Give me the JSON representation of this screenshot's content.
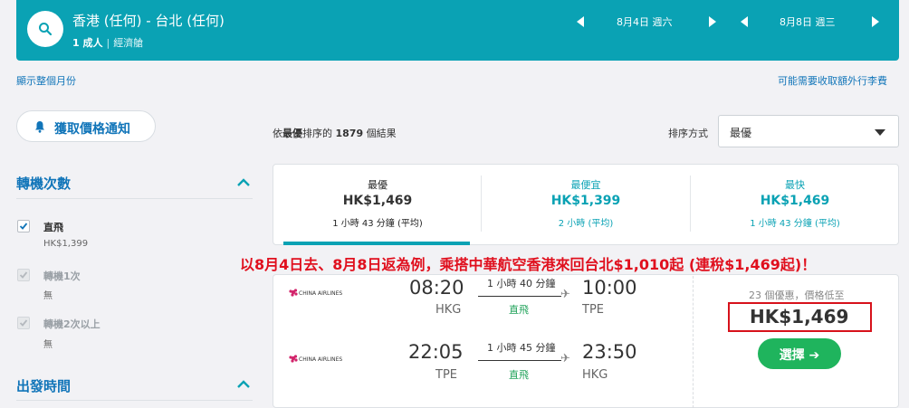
{
  "header": {
    "route": "香港 (任何) - 台北 (任何)",
    "passengers": "1 成人",
    "cabin": "經濟艙",
    "depart_date": "8月4日 週六",
    "return_date": "8月8日 週三"
  },
  "links": {
    "show_month": "顯示整個月份",
    "baggage_fee": "可能需要收取額外行李費"
  },
  "sidebar": {
    "price_alert": "獲取價格通知",
    "stops_title": "轉機次數",
    "stops": [
      {
        "label": "直飛",
        "sub": "HK$1,399",
        "checked": true,
        "disabled": false
      },
      {
        "label": "轉機1次",
        "sub": "無",
        "checked": true,
        "disabled": true
      },
      {
        "label": "轉機2次以上",
        "sub": "無",
        "checked": true,
        "disabled": true
      }
    ],
    "departure_title": "出發時間"
  },
  "results": {
    "prefix": "依",
    "sort_name": "最優",
    "middle": "排序的",
    "count": "1879",
    "suffix": "個結果",
    "sort_label": "排序方式",
    "sort_value": "最優"
  },
  "tabs": [
    {
      "label": "最優",
      "price": "HK$1,469",
      "duration": "1 小時 43 分鐘 (平均)"
    },
    {
      "label": "最便宜",
      "price": "HK$1,399",
      "duration": "2 小時 (平均)"
    },
    {
      "label": "最快",
      "price": "HK$1,469",
      "duration": "1 小時 43 分鐘 (平均)"
    }
  ],
  "annotation": "以8月4日去、8月8日返為例，乘搭中華航空香港來回台北$1,010起 (連稅$1,469起)！",
  "flight": {
    "airline": "CHINA AIRLINES",
    "outbound": {
      "depart": "08:20",
      "from": "HKG",
      "duration": "1 小時 40 分鐘",
      "stops": "直飛",
      "arrive": "10:00",
      "to": "TPE"
    },
    "inbound": {
      "depart": "22:05",
      "from": "TPE",
      "duration": "1 小時 45 分鐘",
      "stops": "直飛",
      "arrive": "23:50",
      "to": "HKG"
    },
    "deals": "23 個優惠，價格低至",
    "price": "HK$1,469",
    "select": "選擇 ➔"
  },
  "colors": {
    "teal": "#0aa2b4",
    "blue": "#1175b9",
    "green": "#1fb45d",
    "red": "#e0101e"
  }
}
